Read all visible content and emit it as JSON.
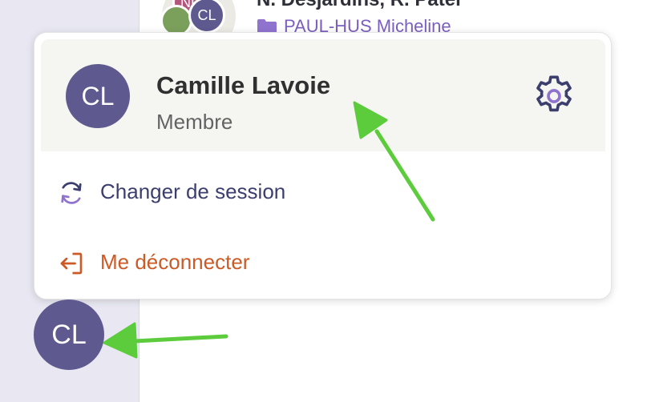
{
  "background_item": {
    "avatars": [
      "ND",
      "CL",
      ""
    ],
    "title": "N. Desjardins, R. Patel",
    "folder_icon": "folder-icon",
    "folder_label": "PAUL-HUS Micheline"
  },
  "profile": {
    "initials": "CL",
    "name": "Camille Lavoie",
    "role": "Membre",
    "settings_icon": "gear-icon"
  },
  "menu": {
    "switch_session": "Changer de session",
    "switch_icon": "refresh-icon",
    "logout": "Me déconnecter",
    "logout_icon": "logout-icon"
  },
  "sidebar": {
    "avatar_initials": "CL"
  },
  "colors": {
    "avatar": "#5e5a8f",
    "switch_text": "#3c3f6e",
    "logout_text": "#cc5a26",
    "annotation_arrow": "#5ccc3c",
    "header_bg": "#f5f6f1",
    "sidebar_bg": "#e9e8f2"
  }
}
